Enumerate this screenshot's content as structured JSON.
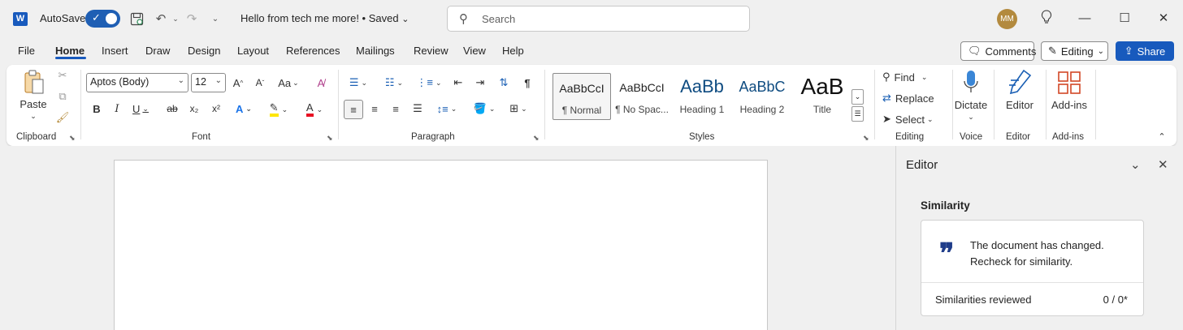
{
  "titlebar": {
    "app_icon": "word-icon",
    "autosave_label": "AutoSave",
    "autosave_on": true,
    "document_title": "Hello from tech me more! • Saved",
    "search_placeholder": "Search",
    "avatar_initials": "MM"
  },
  "tabs": [
    "File",
    "Home",
    "Insert",
    "Draw",
    "Design",
    "Layout",
    "References",
    "Mailings",
    "Review",
    "View",
    "Help"
  ],
  "active_tab": "Home",
  "right_buttons": {
    "comments": "Comments",
    "editing": "Editing",
    "share": "Share"
  },
  "ribbon": {
    "clipboard": {
      "paste": "Paste",
      "label": "Clipboard"
    },
    "font": {
      "font_name": "Aptos (Body)",
      "font_size": "12",
      "change_case": "Aa",
      "label": "Font"
    },
    "paragraph": {
      "label": "Paragraph"
    },
    "styles": {
      "items": [
        {
          "sample": "AaBbCcI",
          "name": "¶ Normal"
        },
        {
          "sample": "AaBbCcI",
          "name": "¶ No Spac..."
        },
        {
          "sample": "AaBb",
          "name": "Heading 1"
        },
        {
          "sample": "AaBbC",
          "name": "Heading 2"
        },
        {
          "sample": "AaB",
          "name": "Title"
        }
      ],
      "label": "Styles"
    },
    "editing": {
      "find": "Find",
      "replace": "Replace",
      "select": "Select",
      "label": "Editing"
    },
    "voice": {
      "dictate": "Dictate",
      "label": "Voice"
    },
    "editor": {
      "editor": "Editor",
      "label": "Editor"
    },
    "addins": {
      "addins": "Add-ins",
      "label": "Add-ins"
    }
  },
  "editor_pane": {
    "title": "Editor",
    "section": "Similarity",
    "message_line1": "The document has changed.",
    "message_line2": "Recheck for similarity.",
    "reviewed_label": "Similarities reviewed",
    "reviewed_value": "0 / 0*"
  },
  "colors": {
    "brand": "#185abd",
    "highlight": "#ffff00",
    "font_color": "#e81123"
  }
}
